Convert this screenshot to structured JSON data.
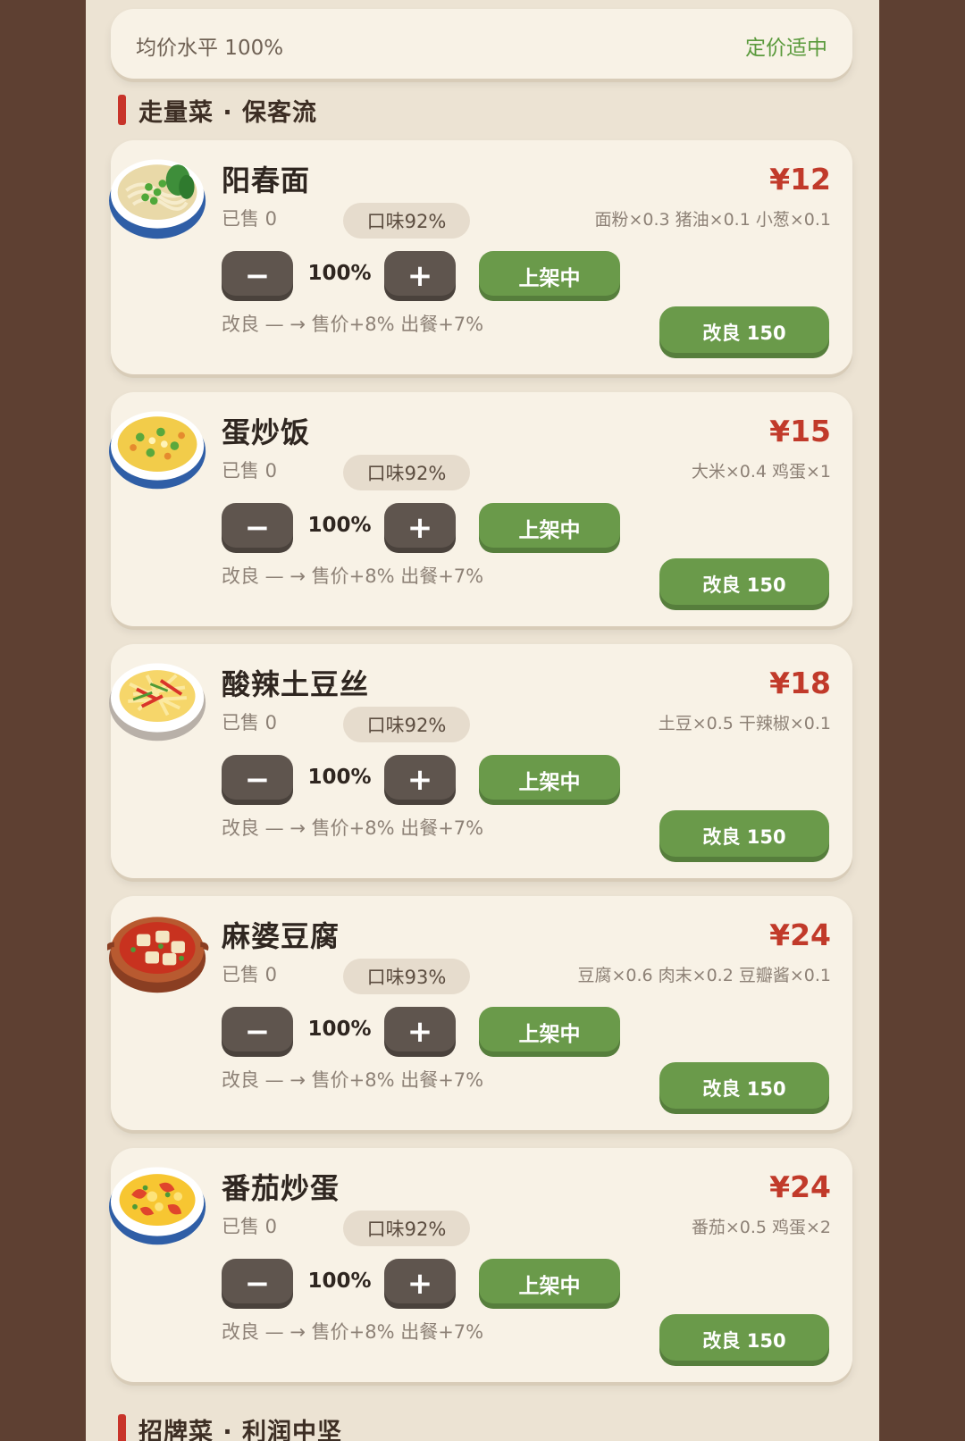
{
  "price_bar": {
    "label": "均价水平 100%",
    "status": "定价适中"
  },
  "section": {
    "title": "走量菜 · 保客流"
  },
  "next_section": {
    "title": "招牌菜 · 利润中坚"
  },
  "dishes": [
    {
      "name": "阳春面",
      "price": "¥12",
      "sold": "已售 0",
      "taste": "口味92%",
      "ingredients": "面粉×0.3  猪油×0.1  小葱×0.1",
      "percent": "100%",
      "minus": "−",
      "plus": "+",
      "list_label": "上架中",
      "improve_text": "改良 — → 售价+8% 出餐+7%",
      "improve_label": "改良 150",
      "icon": "noodle-bowl-icon"
    },
    {
      "name": "蛋炒饭",
      "price": "¥15",
      "sold": "已售 0",
      "taste": "口味92%",
      "ingredients": "大米×0.4  鸡蛋×1",
      "percent": "100%",
      "minus": "−",
      "plus": "+",
      "list_label": "上架中",
      "improve_text": "改良 — → 售价+8% 出餐+7%",
      "improve_label": "改良 150",
      "icon": "fried-rice-icon"
    },
    {
      "name": "酸辣土豆丝",
      "price": "¥18",
      "sold": "已售 0",
      "taste": "口味92%",
      "ingredients": "土豆×0.5  干辣椒×0.1",
      "percent": "100%",
      "minus": "−",
      "plus": "+",
      "list_label": "上架中",
      "improve_text": "改良 — → 售价+8% 出餐+7%",
      "improve_label": "改良 150",
      "icon": "shredded-potato-icon"
    },
    {
      "name": "麻婆豆腐",
      "price": "¥24",
      "sold": "已售 0",
      "taste": "口味93%",
      "ingredients": "豆腐×0.6  肉末×0.2  豆瓣酱×0.1",
      "percent": "100%",
      "minus": "−",
      "plus": "+",
      "list_label": "上架中",
      "improve_text": "改良 — → 售价+8% 出餐+7%",
      "improve_label": "改良 150",
      "icon": "mapo-tofu-icon"
    },
    {
      "name": "番茄炒蛋",
      "price": "¥24",
      "sold": "已售 0",
      "taste": "口味92%",
      "ingredients": "番茄×0.5  鸡蛋×2",
      "percent": "100%",
      "minus": "−",
      "plus": "+",
      "list_label": "上架中",
      "improve_text": "改良 — → 售价+8% 出餐+7%",
      "improve_label": "改良 150",
      "icon": "tomato-egg-icon"
    }
  ],
  "colors": {
    "background": "#5e4032",
    "panel": "#ece3d3",
    "card": "#f8f2e6",
    "accent_green": "#6a9a4a",
    "price_red": "#c13a2a",
    "dark_button": "#5f554e",
    "section_marker": "#c8342a"
  }
}
